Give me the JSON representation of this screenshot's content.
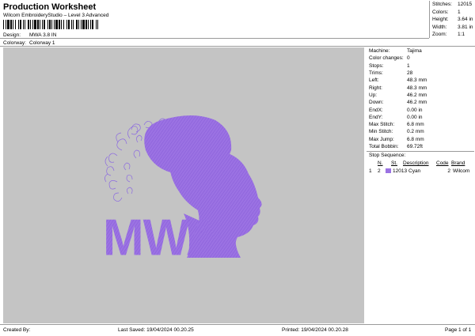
{
  "header": {
    "title": "Production Worksheet",
    "subtitle": "Wilcom EmbroideryStudio – Level 3 Advanced",
    "design_label": "Design:",
    "design_value": "MWA 3.8 IN",
    "colorway_label": "Colorway:",
    "colorway_value": "Colorway 1"
  },
  "stats": [
    {
      "k": "Stitches:",
      "v": "12015"
    },
    {
      "k": "Colors:",
      "v": "1"
    },
    {
      "k": "Height:",
      "v": "3.64 in"
    },
    {
      "k": "Width:",
      "v": "3.81 in"
    },
    {
      "k": "Zoom:",
      "v": "1:1"
    }
  ],
  "design": {
    "text": "MWA",
    "thread_color": "#9b72e3"
  },
  "machine_info": [
    {
      "k": "Machine:",
      "v": "Tajima"
    },
    {
      "k": "Color changes:",
      "v": "0"
    },
    {
      "k": "Stops:",
      "v": "1"
    },
    {
      "k": "Trims:",
      "v": "28"
    },
    {
      "k": "Left:",
      "v": "48.3 mm"
    },
    {
      "k": "Right:",
      "v": "48.3 mm"
    },
    {
      "k": "Up:",
      "v": "46.2 mm"
    },
    {
      "k": "Down:",
      "v": "46.2 mm"
    },
    {
      "k": "EndX:",
      "v": "0.00 in"
    },
    {
      "k": "EndY:",
      "v": "0.00 in"
    },
    {
      "k": "Max Stitch:",
      "v": "6.8 mm"
    },
    {
      "k": "Min Stitch:",
      "v": "0.2 mm"
    },
    {
      "k": "Max Jump:",
      "v": "6.8 mm"
    },
    {
      "k": "Total Bobbin:",
      "v": "69.72ft"
    }
  ],
  "stop_sequence": {
    "title": "Stop Sequence:",
    "headers": {
      "n": "N.",
      "st": "St.",
      "description": "Description",
      "code": "Code",
      "brand": "Brand"
    },
    "rows": [
      {
        "idx": "1",
        "n": "2",
        "st": "12013",
        "description": "Cyan",
        "code": "2",
        "brand": "Wilcom",
        "swatch": "#9b72e3"
      }
    ]
  },
  "footer": {
    "created_by": "Created By:",
    "last_saved": "Last Saved: 19/04/2024 00.20.25",
    "printed": "Printed: 19/04/2024 00.20.28",
    "page": "Page 1 of 1"
  }
}
